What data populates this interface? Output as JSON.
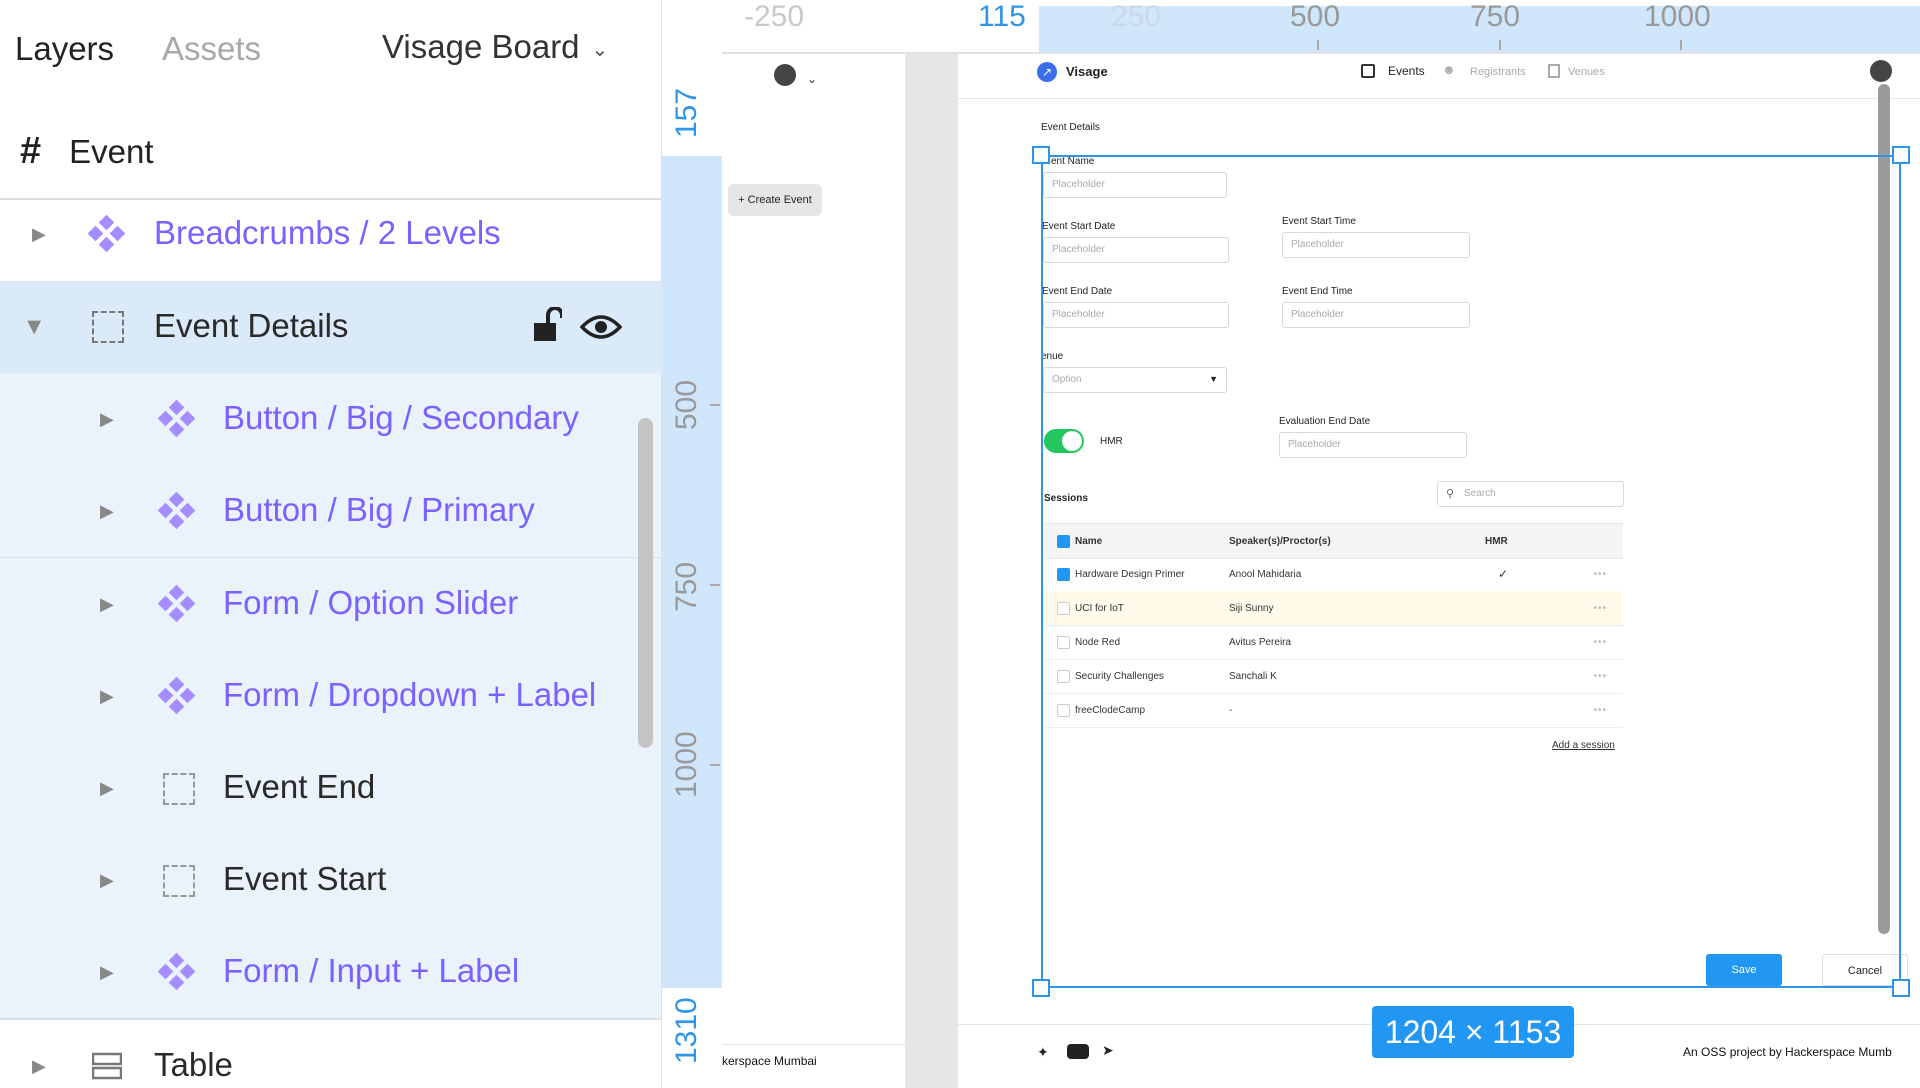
{
  "layers_panel": {
    "tabs": [
      "Layers",
      "Assets"
    ],
    "board_name": "Visage Board",
    "page_name": "Event",
    "layers": [
      {
        "label": "Breadcrumbs / 2 Levels",
        "kind": "component"
      },
      {
        "label": "Event Details",
        "kind": "frame",
        "selected": true
      },
      {
        "label": "Button / Big / Secondary",
        "kind": "component"
      },
      {
        "label": "Button / Big / Primary",
        "kind": "component"
      },
      {
        "label": "Form / Option Slider",
        "kind": "component"
      },
      {
        "label": "Form / Dropdown + Label",
        "kind": "component"
      },
      {
        "label": "Event End",
        "kind": "frame"
      },
      {
        "label": "Event Start",
        "kind": "frame"
      },
      {
        "label": "Form / Input + Label",
        "kind": "component"
      },
      {
        "label": "Table",
        "kind": "table"
      }
    ]
  },
  "rulers": {
    "horizontal": [
      "-250",
      "115",
      "250",
      "500",
      "750",
      "1000"
    ],
    "vertical": [
      "157",
      "500",
      "750",
      "1000",
      "1310"
    ]
  },
  "selection": {
    "size_label": "1204 × 1153"
  },
  "left_frame": {
    "create_event_label": "+ Create Event",
    "footer_text": "kerspace Mumbai"
  },
  "app": {
    "brand": "Visage",
    "nav": [
      "Events",
      "Registrants",
      "Venues"
    ],
    "section_title": "Event Details",
    "fields": {
      "event_name": {
        "label": "ent Name",
        "placeholder": "Placeholder"
      },
      "start_date": {
        "label": "Event Start Date",
        "placeholder": "Placeholder"
      },
      "start_time": {
        "label": "Event Start Time",
        "placeholder": "Placeholder"
      },
      "end_date": {
        "label": "Event End Date",
        "placeholder": "Placeholder"
      },
      "end_time": {
        "label": "Event End Time",
        "placeholder": "Placeholder"
      },
      "venue": {
        "label": "enue",
        "value": "Option"
      },
      "hmr": {
        "label": "HMR"
      },
      "evaluation_end_date": {
        "label": "Evaluation End Date",
        "placeholder": "Placeholder"
      }
    },
    "sessions": {
      "title": "Sessions",
      "search_placeholder": "Search",
      "columns": [
        "Name",
        "Speaker(s)/Proctor(s)",
        "HMR"
      ],
      "rows": [
        {
          "name": "Hardware Design Primer",
          "speaker": "Anool Mahidaria",
          "hmr": "✓",
          "checked": true
        },
        {
          "name": "UCI  for IoT",
          "speaker": "Siji Sunny",
          "hmr": "",
          "checked": false
        },
        {
          "name": "Node Red",
          "speaker": "Avitus Pereira",
          "hmr": "",
          "checked": false
        },
        {
          "name": "Security Challenges",
          "speaker": "Sanchali K",
          "hmr": "",
          "checked": false
        },
        {
          "name": "freeClodeCamp",
          "speaker": "-",
          "hmr": "",
          "checked": false
        }
      ],
      "add_link": "Add a session"
    },
    "save_label": "Save",
    "cancel_label": "Cancel",
    "footer_text": "An OSS project by Hackerspace Mumb"
  },
  "colors": {
    "accent": "#2196f3",
    "purple": "#7b61ff",
    "toggle_on": "#22c55e",
    "selection": "#2f95e8"
  }
}
